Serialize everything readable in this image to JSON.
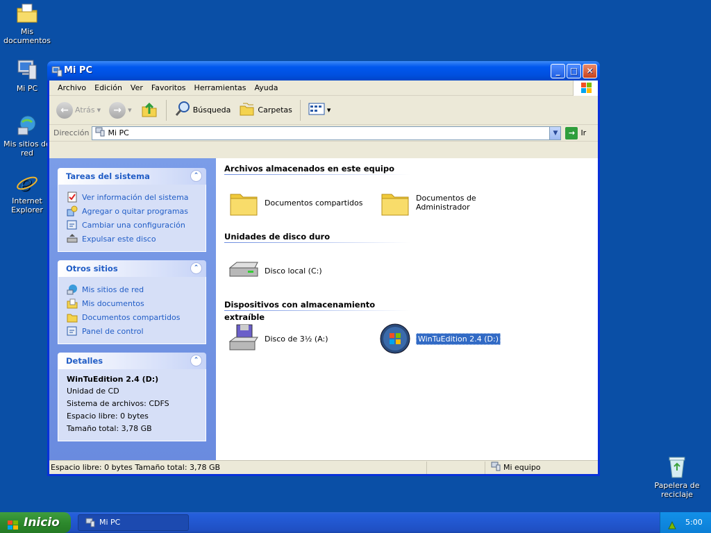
{
  "desktop": {
    "icons": [
      {
        "label": "Mis documentos"
      },
      {
        "label": "Mi PC"
      },
      {
        "label": "Mis sitios de red"
      },
      {
        "label": "Internet Explorer"
      },
      {
        "label": "Papelera de reciclaje"
      }
    ]
  },
  "window": {
    "title": "Mi PC",
    "menu": [
      "Archivo",
      "Edición",
      "Ver",
      "Favoritos",
      "Herramientas",
      "Ayuda"
    ],
    "toolbar": {
      "back": "Atrás",
      "search": "Búsqueda",
      "folders": "Carpetas"
    },
    "address": {
      "label": "Dirección",
      "value": "Mi PC",
      "go": "Ir"
    },
    "left": {
      "system_tasks": {
        "title": "Tareas del sistema",
        "items": [
          "Ver información del sistema",
          "Agregar o quitar programas",
          "Cambiar una configuración",
          "Expulsar este disco"
        ]
      },
      "other_places": {
        "title": "Otros sitios",
        "items": [
          "Mis sitios de red",
          "Mis documentos",
          "Documentos compartidos",
          "Panel de control"
        ]
      },
      "details": {
        "title": "Detalles",
        "name": "WinTuEdition 2.4 (D:)",
        "type": "Unidad de CD",
        "fs": "Sistema de archivos: CDFS",
        "free": "Espacio libre: 0 bytes",
        "total": "Tamaño total: 3,78 GB"
      }
    },
    "main": {
      "groups": [
        {
          "title": "Archivos almacenados en este equipo",
          "items": [
            "Documentos compartidos",
            "Documentos de Administrador"
          ]
        },
        {
          "title": "Unidades de disco duro",
          "items": [
            "Disco local (C:)"
          ]
        },
        {
          "title": "Dispositivos con almacenamiento extraíble",
          "items": [
            "Disco de 3½ (A:)",
            "WinTuEdition 2.4 (D:)"
          ]
        }
      ]
    },
    "status": {
      "left": "Espacio libre: 0 bytes Tamaño total: 3,78 GB",
      "right": "Mi equipo"
    }
  },
  "taskbar": {
    "start": "Inicio",
    "task": "Mi PC",
    "clock": "5:00"
  },
  "colors": {
    "desktop": "#0a4fa6",
    "title_bar": "#0058ee",
    "left_pane": "#7b9de8",
    "link": "#215dc6",
    "selection": "#316ac5"
  }
}
